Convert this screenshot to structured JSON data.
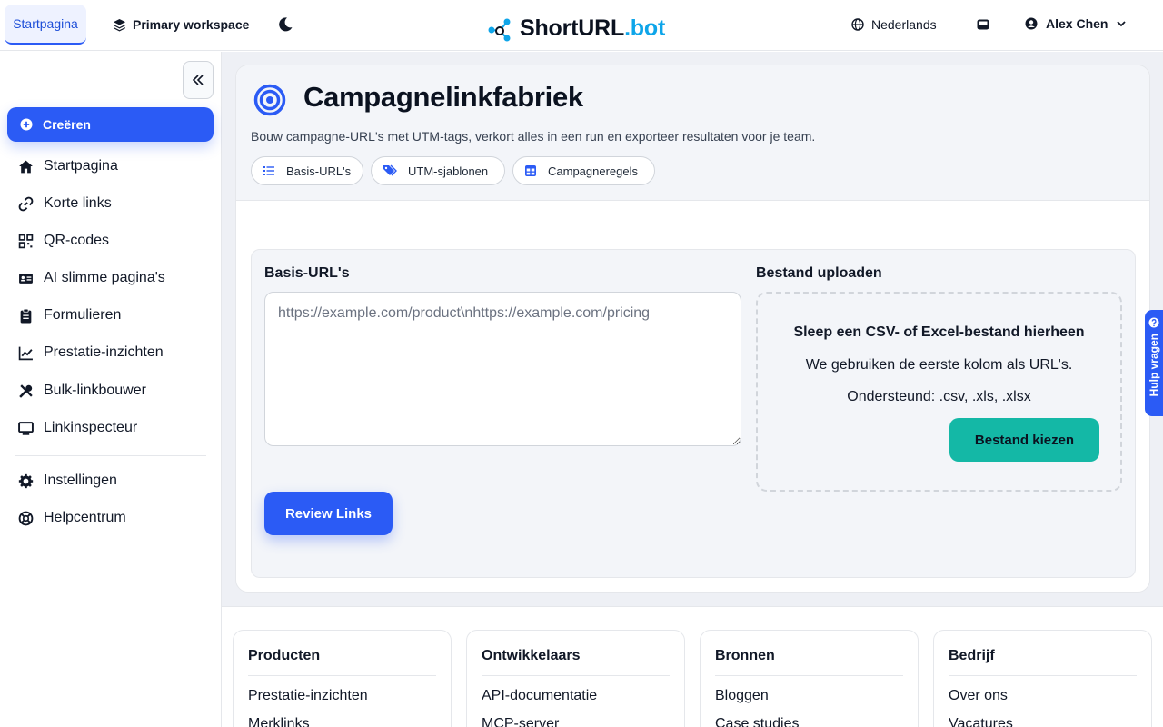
{
  "topbar": {
    "home_tab": "Startpagina",
    "workspace": "Primary workspace",
    "logo_main": "ShortURL",
    "logo_accent": ".bot",
    "language": "Nederlands",
    "user_name": "Alex Chen"
  },
  "sidebar": {
    "create_label": "Creëren",
    "items": [
      {
        "label": "Startpagina",
        "icon": "home-icon"
      },
      {
        "label": "Korte links",
        "icon": "link-icon"
      },
      {
        "label": "QR-codes",
        "icon": "qr-icon"
      },
      {
        "label": "AI slimme pagina's",
        "icon": "id-card-icon"
      },
      {
        "label": "Formulieren",
        "icon": "clipboard-icon"
      },
      {
        "label": "Prestatie-inzichten",
        "icon": "chart-line-icon"
      },
      {
        "label": "Bulk-linkbouwer",
        "icon": "tools-icon"
      },
      {
        "label": "Linkinspecteur",
        "icon": "monitor-icon"
      }
    ],
    "bottom_items": [
      {
        "label": "Instellingen",
        "icon": "gear-icon"
      },
      {
        "label": "Helpcentrum",
        "icon": "lifebuoy-icon"
      }
    ]
  },
  "page": {
    "title": "Campagnelinkfabriek",
    "subtitle": "Bouw campagne-URL's met UTM-tags, verkort alles in een run en exporteer resultaten voor je team.",
    "chips": [
      "Basis-URL's",
      "UTM-sjablonen",
      "Campagneregels"
    ]
  },
  "form": {
    "base_urls_label": "Basis-URL's",
    "base_urls_placeholder": "https://example.com/product\\nhttps://example.com/pricing",
    "upload_label": "Bestand uploaden",
    "dropzone_title": "Sleep een CSV- of Excel-bestand hierheen",
    "dropzone_hint": "We gebruiken de eerste kolom als URL's.",
    "dropzone_supported": "Ondersteund: .csv, .xls, .xlsx",
    "file_button": "Bestand kiezen",
    "review_button": "Review Links"
  },
  "footer": {
    "columns": [
      {
        "title": "Producten",
        "links": [
          "Prestatie-inzichten",
          "Merklinks"
        ]
      },
      {
        "title": "Ontwikkelaars",
        "links": [
          "API-documentatie",
          "MCP-server"
        ]
      },
      {
        "title": "Bronnen",
        "links": [
          "Bloggen",
          "Case studies"
        ]
      },
      {
        "title": "Bedrijf",
        "links": [
          "Over ons",
          "Vacatures"
        ]
      }
    ]
  },
  "help_tab": "Hulp vragen",
  "colors": {
    "primary": "#2b5bf5",
    "teal": "#14b8a6",
    "logo_accent": "#0ea5e9"
  }
}
